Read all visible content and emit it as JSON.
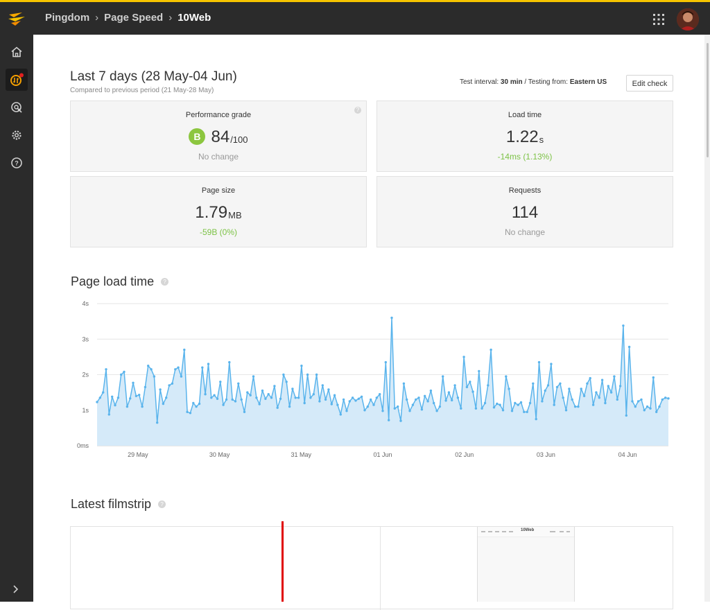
{
  "topbar": {
    "breadcrumbs": [
      "Pingdom",
      "Page Speed",
      "10Web"
    ],
    "brand_color": "#f6c400"
  },
  "sidebar": {
    "items": [
      {
        "icon": "home-icon",
        "active": false
      },
      {
        "icon": "pagespeed-icon",
        "active": true
      },
      {
        "icon": "rum-icon",
        "active": false
      },
      {
        "icon": "settings-icon",
        "active": false
      },
      {
        "icon": "help-icon",
        "active": false
      }
    ],
    "expand_icon": "chevron-right-icon"
  },
  "header": {
    "title": "Last 7 days (28 May-04 Jun)",
    "subtitle": "Compared to previous period (21 May-28 May)",
    "test_interval_label": "Test interval:",
    "test_interval_value": "30 min",
    "separator": "/",
    "testing_from_label": "Testing from:",
    "testing_from_value": "Eastern US",
    "edit_button": "Edit check"
  },
  "cards": {
    "performance": {
      "label": "Performance grade",
      "grade": "B",
      "value": "84",
      "unit": "/100",
      "change": "No change",
      "help": "?"
    },
    "load_time": {
      "label": "Load time",
      "value": "1.22",
      "unit": "s",
      "change": "-14ms (1.13%)"
    },
    "page_size": {
      "label": "Page size",
      "value": "1.79",
      "unit": "MB",
      "change": "-59B (0%)"
    },
    "requests": {
      "label": "Requests",
      "value": "114",
      "change": "No change"
    }
  },
  "colors": {
    "grade_b": "#8cc63f",
    "positive": "#7cc245",
    "line": "#5ab4ec",
    "area": "#d5eaf9"
  },
  "sections": {
    "page_load_title": "Page load time",
    "filmstrip_title": "Latest filmstrip",
    "help": "?"
  },
  "chart_data": {
    "type": "area",
    "title": "Page load time",
    "ylabel": "",
    "yticks": [
      "0ms",
      "1s",
      "2s",
      "3s",
      "4s"
    ],
    "ylim": [
      0,
      4
    ],
    "xticks": [
      "29 May",
      "30 May",
      "31 May",
      "01 Jun",
      "02 Jun",
      "03 Jun",
      "04 Jun"
    ],
    "grid": true,
    "series": [
      {
        "values": [
          1.23,
          1.35,
          1.5,
          2.15,
          0.88,
          1.38,
          1.14,
          1.35,
          2.0,
          2.08,
          1.1,
          1.33,
          1.77,
          1.4,
          1.43,
          1.1,
          1.65,
          2.25,
          2.15,
          1.95,
          0.65,
          1.58,
          1.18,
          1.35,
          1.7,
          1.75,
          2.15,
          2.2,
          1.95,
          2.7,
          0.95,
          0.92,
          1.2,
          1.1,
          1.18,
          2.2,
          1.45,
          2.3,
          1.35,
          1.42,
          1.32,
          1.8,
          1.15,
          1.3,
          2.35,
          1.3,
          1.25,
          1.75,
          1.3,
          0.95,
          1.5,
          1.42,
          1.95,
          1.35,
          1.17,
          1.55,
          1.32,
          1.45,
          1.35,
          1.68,
          1.07,
          1.32,
          2.0,
          1.8,
          1.1,
          1.6,
          1.35,
          1.35,
          2.25,
          1.2,
          2.0,
          1.35,
          1.45,
          2.0,
          1.25,
          1.7,
          1.3,
          1.58,
          1.17,
          1.42,
          1.15,
          0.88,
          1.3,
          0.98,
          1.25,
          1.35,
          1.27,
          1.32,
          1.38,
          1.0,
          1.1,
          1.3,
          1.15,
          1.35,
          1.45,
          0.98,
          2.35,
          0.72,
          3.6,
          1.05,
          1.1,
          0.7,
          1.75,
          1.3,
          0.98,
          1.15,
          1.3,
          1.35,
          1.02,
          1.4,
          1.25,
          1.55,
          1.2,
          0.98,
          1.1,
          1.95,
          1.27,
          1.5,
          1.28,
          1.7,
          1.35,
          1.05,
          2.5,
          1.65,
          1.8,
          1.52,
          1.05,
          2.1,
          1.05,
          1.2,
          1.7,
          2.7,
          1.08,
          1.18,
          1.15,
          1.0,
          1.95,
          1.6,
          0.98,
          1.2,
          1.15,
          1.22,
          0.95,
          0.95,
          1.2,
          1.75,
          0.75,
          2.35,
          1.25,
          1.55,
          1.7,
          2.3,
          1.15,
          1.65,
          1.75,
          1.35,
          1.0,
          1.6,
          1.3,
          1.1,
          1.1,
          1.6,
          1.4,
          1.75,
          1.9,
          1.15,
          1.5,
          1.35,
          1.85,
          1.2,
          1.68,
          1.5,
          1.95,
          1.3,
          1.68,
          3.38,
          0.85,
          2.78,
          1.25,
          1.1,
          1.25,
          1.3,
          1.0,
          1.1,
          1.05,
          1.92,
          0.95,
          1.1,
          1.3,
          1.35,
          1.33
        ]
      }
    ]
  },
  "filmstrip": {
    "frame_brand": "10Web"
  }
}
